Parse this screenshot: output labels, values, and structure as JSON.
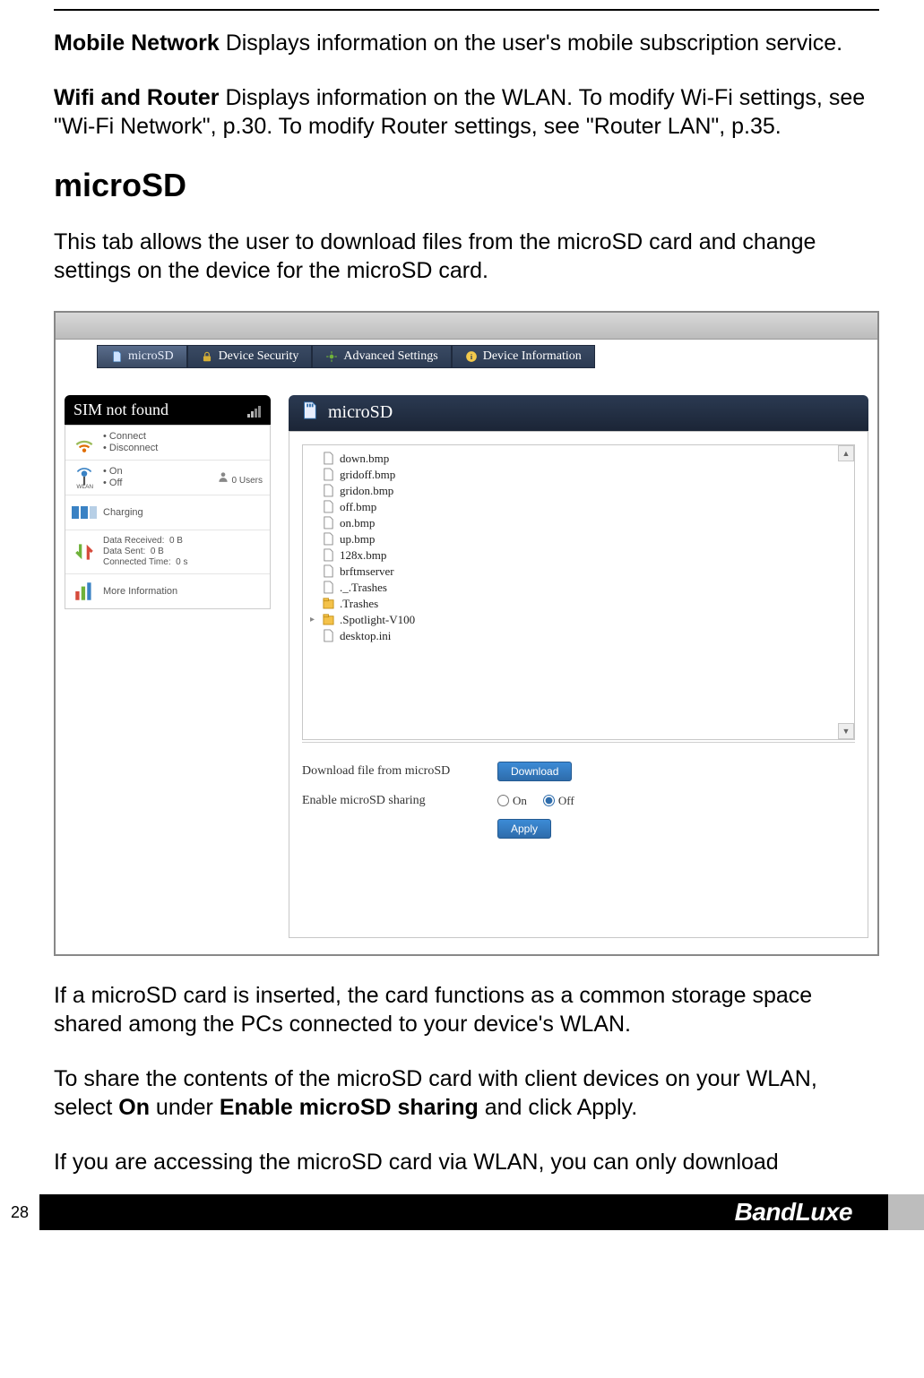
{
  "text": {
    "p1a": "Mobile Network",
    "p1b": " Displays information on the user's mobile subscription service.",
    "p2a": "Wifi and Router",
    "p2b": " Displays information on the WLAN. To modify Wi-Fi settings, see \"Wi-Fi Network\", p.30. To modify Router settings, see \"Router LAN\", p.35.",
    "heading": "microSD",
    "p3": "This tab allows the user to download files from the microSD card and change settings on the device for the microSD card.",
    "p4": "If a microSD card is inserted, the card functions as a common storage space shared among the PCs connected to your device's WLAN.",
    "p5a": "To share the contents of the microSD card with client devices on your WLAN, select ",
    "p5b": "On",
    "p5c": " under ",
    "p5d": "Enable microSD sharing",
    "p5e": " and click Apply.",
    "p6": "If you are accessing the microSD card via WLAN, you can only download"
  },
  "screenshot": {
    "tabs": [
      {
        "label": "microSD",
        "icon": "sd",
        "active": true
      },
      {
        "label": "Device Security",
        "icon": "lock",
        "active": false
      },
      {
        "label": "Advanced Settings",
        "icon": "gear",
        "active": false
      },
      {
        "label": "Device Information",
        "icon": "info",
        "active": false
      }
    ],
    "sidebar": {
      "header": "SIM not found",
      "rows": {
        "conn": {
          "a": "Connect",
          "b": "Disconnect"
        },
        "wlan": {
          "on": "On",
          "off": "Off",
          "users": "0 Users",
          "label": "WLAN"
        },
        "charging": "Charging",
        "stats": {
          "a": "Data Received:",
          "av": "0 B",
          "b": "Data Sent:",
          "bv": "0 B",
          "c": "Connected Time:",
          "cv": "0 s"
        },
        "more": "More Information"
      }
    },
    "content": {
      "title": "microSD",
      "files": [
        {
          "name": "down.bmp",
          "type": "file"
        },
        {
          "name": "gridoff.bmp",
          "type": "file"
        },
        {
          "name": "gridon.bmp",
          "type": "file"
        },
        {
          "name": "off.bmp",
          "type": "file"
        },
        {
          "name": "on.bmp",
          "type": "file"
        },
        {
          "name": "up.bmp",
          "type": "file"
        },
        {
          "name": "128x.bmp",
          "type": "file"
        },
        {
          "name": "brftmserver",
          "type": "file"
        },
        {
          "name": "._.Trashes",
          "type": "file"
        },
        {
          "name": ".Trashes",
          "type": "folder"
        },
        {
          "name": ".Spotlight-V100",
          "type": "folder",
          "hasChildren": true
        },
        {
          "name": "desktop.ini",
          "type": "file"
        }
      ],
      "downloadLabel": "Download file from microSD",
      "downloadBtn": "Download",
      "shareLabel": "Enable microSD sharing",
      "radioOn": "On",
      "radioOff": "Off",
      "applyBtn": "Apply"
    }
  },
  "footer": {
    "page": "28",
    "brand": "BandLuxe"
  }
}
